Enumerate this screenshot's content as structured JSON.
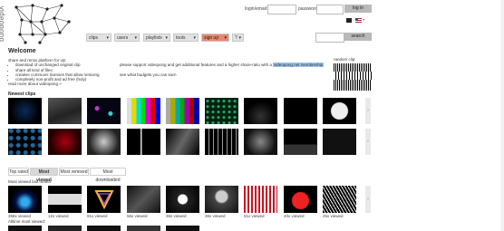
{
  "brand": {
    "name": "videopong"
  },
  "login": {
    "login_label": "login/email:",
    "password_label": "password:",
    "button": "log in"
  },
  "nav": {
    "items": [
      {
        "label": "clips"
      },
      {
        "label": "users"
      },
      {
        "label": "playlists"
      },
      {
        "label": "tools"
      },
      {
        "label": "sign up"
      },
      {
        "label": "?"
      }
    ],
    "search_button": "search"
  },
  "welcome": {
    "title": "Welcome",
    "intro": "share and remix platform for vjs:",
    "features": [
      "download of unchanged original clip",
      "share all kind of files",
      "creative commons licenses that allow remixing",
      "completely non-profit and ad free (holy)"
    ],
    "read_more": "read more about videopong »",
    "support_prefix": "please support videopong and get additional features and a higher share-ratio with a ",
    "support_link": "videopong.net membership",
    "budget_text": "see what budgets you can earn",
    "random_clip_label": "random clip:"
  },
  "newest": {
    "title": "Newest clips"
  },
  "tabs": [
    {
      "label": "Top rated",
      "active": false
    },
    {
      "label": "Most viewed",
      "active": true
    },
    {
      "label": "Most remixed",
      "active": false
    },
    {
      "label": "Most downloaded",
      "active": false
    }
  ],
  "most_viewed": {
    "last_month_label": "Most viewed last month:",
    "alltime_label": "Alltime most viewed:",
    "counts": [
      "358x viewed",
      "12x viewed",
      "91x viewed",
      "56x viewed",
      "38x viewed",
      "36x viewed",
      "51x viewed",
      "40x viewed",
      "45x viewed"
    ]
  },
  "colors": {
    "signup": "#e8876f",
    "button": "#b9b9b9",
    "highlight": "#9cc6f0"
  }
}
